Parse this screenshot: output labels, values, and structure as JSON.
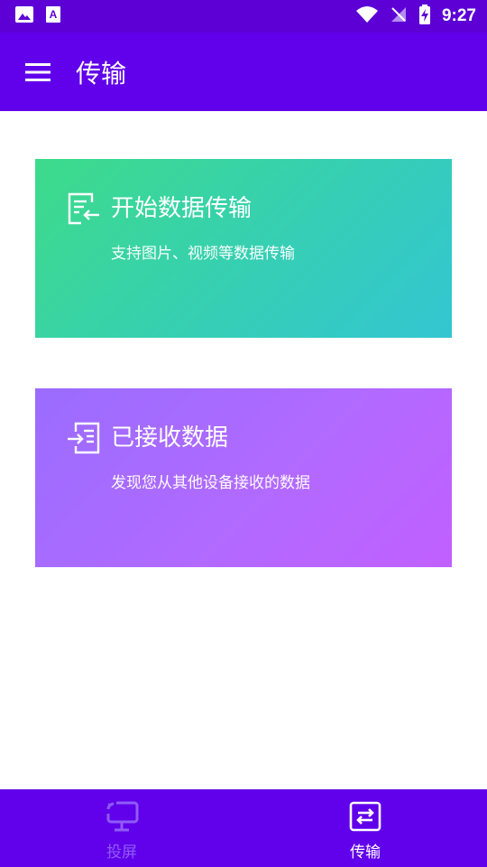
{
  "status_bar": {
    "time": "9:27",
    "icons": [
      "image-icon",
      "text-recognition-icon",
      "wifi-icon",
      "no-signal-icon",
      "battery-charging-icon"
    ]
  },
  "app_bar": {
    "menu_icon": "menu-icon",
    "title": "传输"
  },
  "cards": {
    "start": {
      "icon": "send-file-icon",
      "title": "开始数据传输",
      "subtitle": "支持图片、视频等数据传输",
      "gradient": [
        "#3ddb8a",
        "#33c6d2"
      ]
    },
    "received": {
      "icon": "receive-file-icon",
      "title": "已接收数据",
      "subtitle": "发现您从其他设备接收的数据",
      "gradient": [
        "#9a6cff",
        "#c160ff"
      ]
    }
  },
  "bottom_nav": {
    "items": [
      {
        "label": "投屏",
        "icon": "screen-cast-icon",
        "active": false
      },
      {
        "label": "传输",
        "icon": "transfer-icon",
        "active": true
      }
    ]
  },
  "colors": {
    "primary": "#6100ea",
    "status_bar": "#5c00d6",
    "inactive_nav": "#8f5cf6"
  }
}
